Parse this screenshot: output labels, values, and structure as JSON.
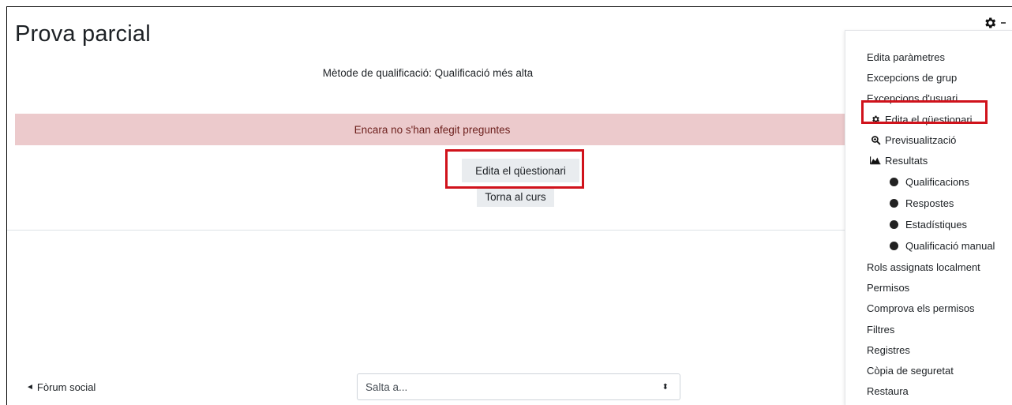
{
  "page": {
    "title": "Prova parcial",
    "grading_method": "Mètode de qualificació: Qualificació més alta",
    "alert": "Encara no s'han afegit preguntes",
    "edit_button": "Edita el qüestionari",
    "back_button": "Torna al curs"
  },
  "footer": {
    "prev_link_arrow": "◄",
    "prev_link": "Fòrum social",
    "jump_placeholder": "Salta a...",
    "jump_caret": "⬍"
  },
  "settings_menu": {
    "icon": "gear-icon",
    "items": [
      {
        "label": "Edita paràmetres"
      },
      {
        "label": "Excepcions de grup"
      },
      {
        "label": "Excepcions d'usuari"
      },
      {
        "label": "Edita el qüestionari",
        "icon": "gear-icon"
      },
      {
        "label": "Previsualització",
        "icon": "zoom-icon"
      },
      {
        "label": "Resultats",
        "icon": "area-chart-icon"
      },
      {
        "label": "Qualificacions",
        "bullet": true
      },
      {
        "label": "Respostes",
        "bullet": true
      },
      {
        "label": "Estadístiques",
        "bullet": true
      },
      {
        "label": "Qualificació manual",
        "bullet": true
      },
      {
        "label": "Rols assignats localment"
      },
      {
        "label": "Permisos"
      },
      {
        "label": "Comprova els permisos"
      },
      {
        "label": "Filtres"
      },
      {
        "label": "Registres"
      },
      {
        "label": "Còpia de seguretat"
      },
      {
        "label": "Restaura"
      }
    ]
  },
  "colors": {
    "alert_bg": "#eccacc",
    "alert_text": "#6e211e",
    "highlight": "#d0121b",
    "button_bg": "#e9ecef"
  }
}
